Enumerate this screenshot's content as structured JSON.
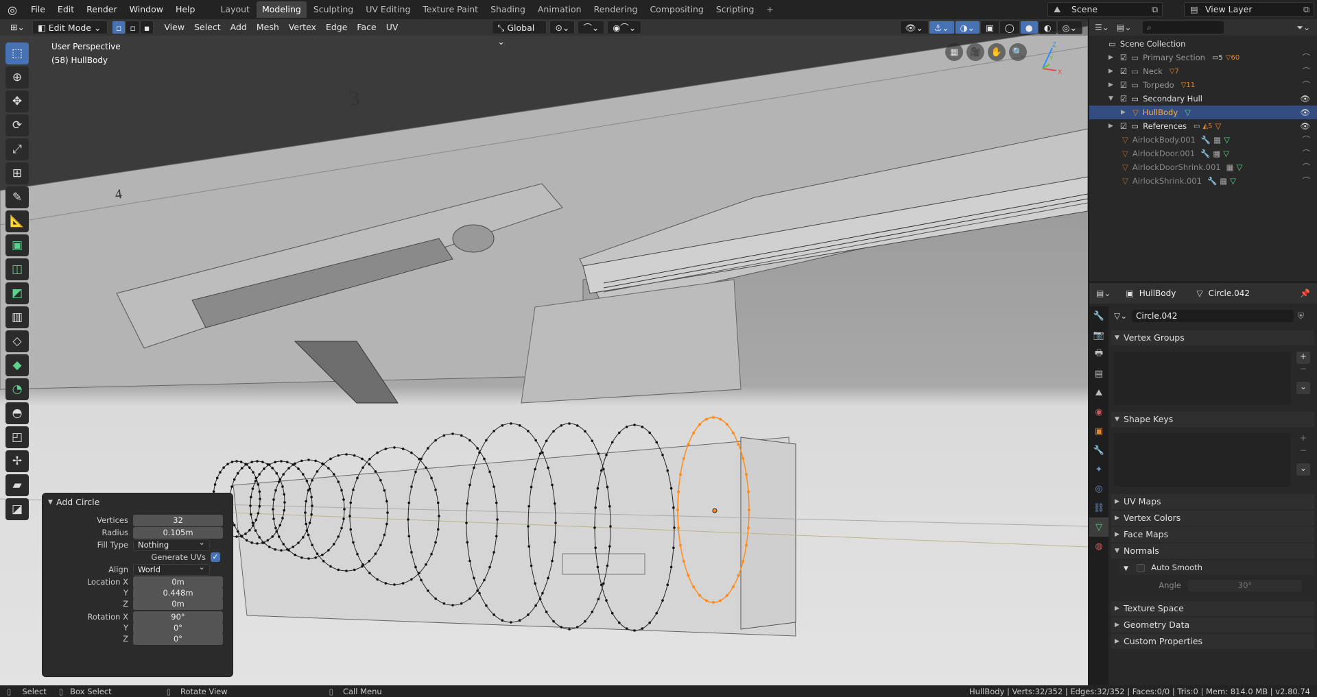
{
  "topbar": {
    "menus": [
      "File",
      "Edit",
      "Render",
      "Window",
      "Help"
    ],
    "workspaces": [
      "Layout",
      "Modeling",
      "Sculpting",
      "UV Editing",
      "Texture Paint",
      "Shading",
      "Animation",
      "Rendering",
      "Compositing",
      "Scripting"
    ],
    "active_workspace": "Modeling",
    "add_tab": "+",
    "scene": "Scene",
    "view_layer": "View Layer"
  },
  "viewport_header": {
    "mode": "Edit Mode",
    "menus": [
      "View",
      "Select",
      "Add",
      "Mesh",
      "Vertex",
      "Edge",
      "Face",
      "UV"
    ],
    "transform_orientation": "Global"
  },
  "viewport": {
    "perspective": "User Perspective",
    "object": "(58) HullBody",
    "hull_markings": [
      "3",
      "4"
    ],
    "gizmo_axes": [
      "Y",
      "X",
      "Z"
    ]
  },
  "toolbar": {
    "tools": [
      "select-box",
      "cursor",
      "move",
      "rotate",
      "scale",
      "transform",
      "annotate",
      "measure",
      "extrude",
      "inset",
      "bevel",
      "loop-cut",
      "knife",
      "poly-build",
      "spin",
      "smooth",
      "edge-slide",
      "shrink-fatten",
      "shear",
      "rip"
    ]
  },
  "operator_panel": {
    "title": "Add Circle",
    "vertices_label": "Vertices",
    "vertices": "32",
    "radius_label": "Radius",
    "radius": "0.105m",
    "fill_type_label": "Fill Type",
    "fill_type": "Nothing",
    "generate_uvs_label": "Generate UVs",
    "align_label": "Align",
    "align": "World",
    "location_x_label": "Location X",
    "location_x": "0m",
    "location_y_label": "Y",
    "location_y": "0.448m",
    "location_z_label": "Z",
    "location_z": "0m",
    "rotation_x_label": "Rotation X",
    "rotation_x": "90°",
    "rotation_y_label": "Y",
    "rotation_y": "0°",
    "rotation_z_label": "Z",
    "rotation_z": "0°"
  },
  "outliner": {
    "root": "Scene Collection",
    "items": [
      {
        "name": "Primary Section",
        "count1": "5",
        "count2": "60"
      },
      {
        "name": "Neck",
        "count1": "7"
      },
      {
        "name": "Torpedo",
        "count1": "11"
      },
      {
        "name": "Secondary Hull"
      },
      {
        "name": "HullBody"
      },
      {
        "name": "References",
        "count1": "5"
      },
      {
        "name": "AirlockBody.001"
      },
      {
        "name": "AirlockDoor.001"
      },
      {
        "name": "AirlockDoorShrink.001"
      },
      {
        "name": "AirlockShrink.001"
      }
    ]
  },
  "properties": {
    "object": "HullBody",
    "mesh": "Circle.042",
    "datablock": "Circle.042",
    "sections": [
      "Vertex Groups",
      "Shape Keys",
      "UV Maps",
      "Vertex Colors",
      "Face Maps",
      "Normals",
      "Texture Space",
      "Geometry Data",
      "Custom Properties"
    ],
    "auto_smooth": "Auto Smooth",
    "angle_label": "Angle",
    "angle": "30°"
  },
  "statusbar": {
    "select": "Select",
    "box_select": "Box Select",
    "rotate_view": "Rotate View",
    "call_menu": "Call Menu",
    "stats": "HullBody | Verts:32/352 | Edges:32/352 | Faces:0/0 | Tris:0 | Mem: 814.0 MB | v2.80.74"
  },
  "colors": {
    "accent": "#4772b3",
    "selection_orange": "#ff8c1a",
    "mesh_green": "#5bd18c"
  }
}
